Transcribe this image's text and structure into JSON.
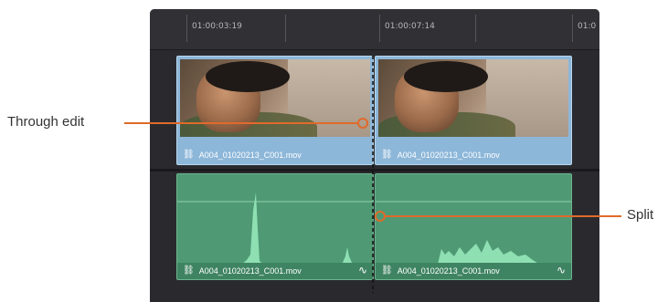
{
  "timeline": {
    "ruler": {
      "timecodes": [
        "01:00:03:19",
        "01:00:07:14",
        "01:0"
      ]
    },
    "video_track": {
      "clips": [
        {
          "name": "A004_01020213_C001.mov"
        },
        {
          "name": "A004_01020213_C001.mov"
        }
      ]
    },
    "audio_track": {
      "clips": [
        {
          "name": "A004_01020213_C001.mov"
        },
        {
          "name": "A004_01020213_C001.mov"
        }
      ]
    }
  },
  "annotations": {
    "through_edit": "Through edit",
    "split": "Split"
  },
  "colors": {
    "video_clip": "#8db7d9",
    "audio_clip": "#4f9a74",
    "annotation": "#e06a2a"
  },
  "icons": {
    "link": "link-icon",
    "fade": "audio-fade-icon"
  }
}
